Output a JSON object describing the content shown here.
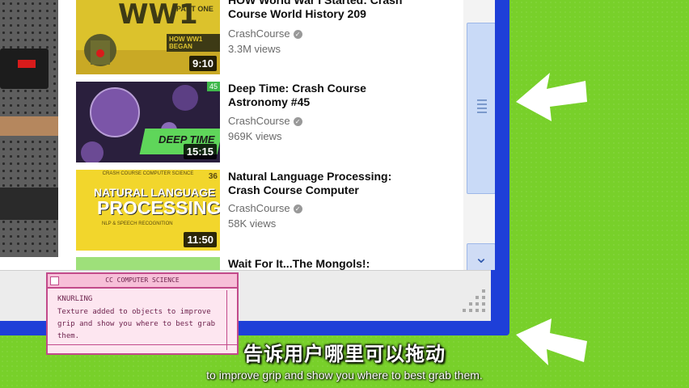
{
  "videos": [
    {
      "title_line1": "HOW World War I Started: Crash",
      "title_line2": "Course World History 209",
      "channel": "CrashCourse",
      "views": "3.3M views",
      "duration": "9:10",
      "thumb_big": "WW1",
      "thumb_small": "PART ONE",
      "thumb_caption": "HOW WW1 BEGAN"
    },
    {
      "title_line1": "Deep Time: Crash Course",
      "title_line2": "Astronomy #45",
      "channel": "CrashCourse",
      "views": "969K views",
      "duration": "15:15",
      "thumb_label": "DEEP TIME",
      "thumb_badge": "45"
    },
    {
      "title_line1": "Natural Language Processing:",
      "title_line2": "Crash Course Computer",
      "channel": "CrashCourse",
      "views": "58K views",
      "duration": "11:50",
      "thumb_top": "CRASH COURSE COMPUTER SCIENCE",
      "thumb_line1": "NATURAL LANGUAGE",
      "thumb_line2": "PROCESSING",
      "thumb_sub": "NLP & SPEECH RECOGNITION",
      "thumb_badge": "36"
    },
    {
      "title_line1": "Wait For It...The Mongols!:"
    }
  ],
  "card": {
    "header": "CC COMPUTER SCIENCE",
    "term": "KNURLING",
    "definition": "Texture added to objects to improve grip and show you where to best grab them."
  },
  "subtitles": {
    "zh": "告诉用户哪里可以拖动",
    "en": "to improve grip and show you where to best grab them."
  },
  "colors": {
    "background": "#78d02a",
    "window_frame": "#1e3fd8",
    "scrollbar_thumb": "#c9daf7",
    "card_accent": "#c24a8a"
  }
}
